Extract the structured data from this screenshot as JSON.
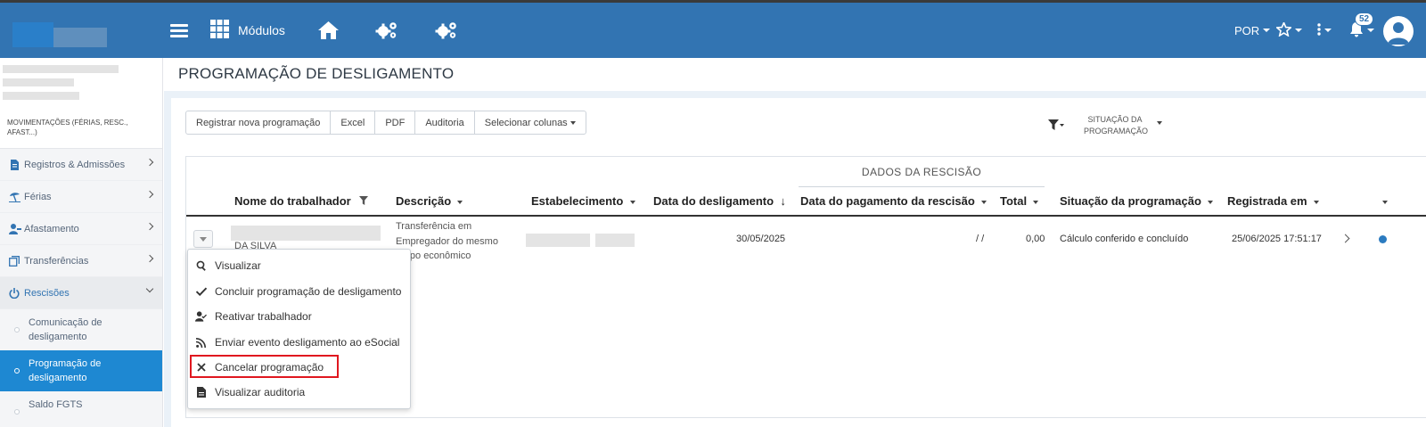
{
  "header": {
    "modules_label": "Módulos",
    "language": "POR",
    "notifications_count": "52"
  },
  "sidebar": {
    "section_title": "MOVIMENTAÇÕES (FÉRIAS, RESC., AFAST...)",
    "items": [
      {
        "label": "Registros & Admissões",
        "icon": "file-icon"
      },
      {
        "label": "Férias",
        "icon": "beach-icon"
      },
      {
        "label": "Afastamento",
        "icon": "user-minus-icon"
      },
      {
        "label": "Transferências",
        "icon": "copy-icon"
      },
      {
        "label": "Rescisões",
        "icon": "power-icon"
      }
    ],
    "subitems": [
      {
        "label": "Comunicação de desligamento"
      },
      {
        "label": "Programação de desligamento"
      },
      {
        "label": "Saldo FGTS"
      }
    ]
  },
  "page": {
    "title": "PROGRAMAÇÃO DE DESLIGAMENTO"
  },
  "toolbar": {
    "buttons": [
      "Registrar nova programação",
      "Excel",
      "PDF",
      "Auditoria",
      "Selecionar colunas"
    ],
    "filter_label": "SITUAÇÃO DA PROGRAMAÇÃO"
  },
  "table": {
    "group_header": "DADOS DA RESCISÃO",
    "columns": [
      "Nome do trabalhador",
      "Descrição",
      "Estabelecimento",
      "Data do desligamento",
      "Data do pagamento da rescisão",
      "Total",
      "Situação da programação",
      "Registrada em"
    ],
    "rows": [
      {
        "nome": "DA SILVA",
        "descricao": [
          "Transferência em",
          "Empregador do mesmo",
          "grupo econômico"
        ],
        "data_desligamento": "30/05/2025",
        "data_pagamento": "/ /",
        "total": "0,00",
        "situacao": "Cálculo conferido e concluído",
        "registrada_em": "25/06/2025 17:51:17"
      }
    ]
  },
  "context_menu": {
    "items": [
      {
        "label": "Visualizar",
        "icon": "search-icon"
      },
      {
        "label": "Concluir programação de desligamento",
        "icon": "check-icon"
      },
      {
        "label": "Reativar trabalhador",
        "icon": "user-check-icon"
      },
      {
        "label": "Enviar evento desligamento ao eSocial",
        "icon": "rss-icon"
      },
      {
        "label": "Cancelar programação",
        "icon": "close-icon"
      },
      {
        "label": "Visualizar auditoria",
        "icon": "document-icon"
      }
    ],
    "highlight_color": "#e0171f"
  },
  "colors": {
    "header_bg": "#3274b2",
    "active_sub_bg": "#1e88d2"
  }
}
